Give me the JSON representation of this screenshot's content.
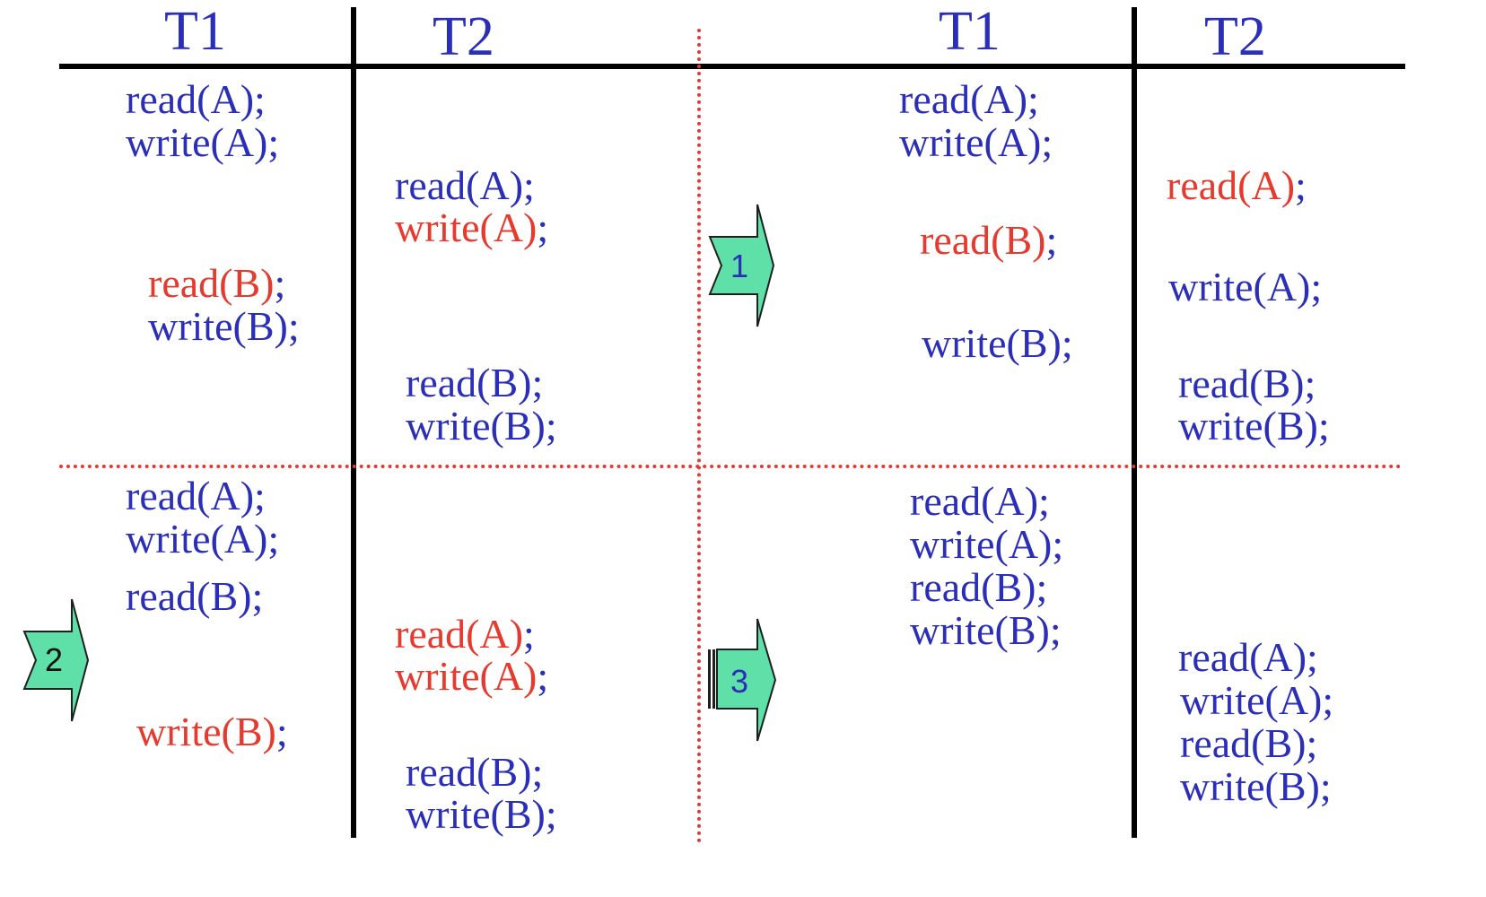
{
  "colors": {
    "text_blue": "#2b2fb8",
    "text_red": "#e63a2e",
    "arrow_fill": "#5ee0a8",
    "divider_red": "#e53935"
  },
  "headers": {
    "left_t1": "T1",
    "left_t2": "T2",
    "right_t1": "T1",
    "right_t2": "T2"
  },
  "arrows": {
    "a1": "1",
    "a2": "2",
    "a3": "3"
  },
  "schedules": {
    "top_left": {
      "t1": [
        {
          "text": "read(A)",
          "semi": ";",
          "highlight": false
        },
        {
          "text": "write(A)",
          "semi": ";",
          "highlight": false
        },
        {
          "text": "read(B)",
          "semi": ";",
          "highlight": true
        },
        {
          "text": "write(B)",
          "semi": ";",
          "highlight": false
        }
      ],
      "t2": [
        {
          "text": "read(A)",
          "semi": ";",
          "highlight": false
        },
        {
          "text": "write(A)",
          "semi": ";",
          "highlight": true
        },
        {
          "text": "read(B)",
          "semi": ";",
          "highlight": false
        },
        {
          "text": "write(B)",
          "semi": ";",
          "highlight": false
        }
      ]
    },
    "top_right": {
      "t1": [
        {
          "text": "read(A)",
          "semi": ";",
          "highlight": false
        },
        {
          "text": "write(A)",
          "semi": ";",
          "highlight": false
        },
        {
          "text": "read(B)",
          "semi": ";",
          "highlight": true
        },
        {
          "text": "write(B)",
          "semi": ";",
          "highlight": false
        }
      ],
      "t2": [
        {
          "text": "read(A)",
          "semi": ";",
          "highlight": true
        },
        {
          "text": "write(A)",
          "semi": ";",
          "highlight": false
        },
        {
          "text": "read(B)",
          "semi": ";",
          "highlight": false
        },
        {
          "text": "write(B)",
          "semi": ";",
          "highlight": false
        }
      ]
    },
    "bottom_left": {
      "t1": [
        {
          "text": "read(A)",
          "semi": ";",
          "highlight": false
        },
        {
          "text": "write(A)",
          "semi": ";",
          "highlight": false
        },
        {
          "text": "read(B)",
          "semi": ";",
          "highlight": false
        },
        {
          "text": "write(B)",
          "semi": ";",
          "highlight": true
        }
      ],
      "t2": [
        {
          "text": "read(A)",
          "semi": ";",
          "highlight": true
        },
        {
          "text": "write(A)",
          "semi": ";",
          "highlight": true
        },
        {
          "text": "read(B)",
          "semi": ";",
          "highlight": false
        },
        {
          "text": "write(B)",
          "semi": ";",
          "highlight": false
        }
      ]
    },
    "bottom_right": {
      "t1": [
        {
          "text": "read(A)",
          "semi": ";",
          "highlight": false
        },
        {
          "text": "write(A)",
          "semi": ";",
          "highlight": false
        },
        {
          "text": "read(B)",
          "semi": ";",
          "highlight": false
        },
        {
          "text": "write(B)",
          "semi": ";",
          "highlight": false
        }
      ],
      "t2": [
        {
          "text": "read(A)",
          "semi": ";",
          "highlight": false
        },
        {
          "text": "write(A)",
          "semi": ";",
          "highlight": false
        },
        {
          "text": "read(B)",
          "semi": ";",
          "highlight": false
        },
        {
          "text": "write(B)",
          "semi": ";",
          "highlight": false
        }
      ]
    }
  }
}
